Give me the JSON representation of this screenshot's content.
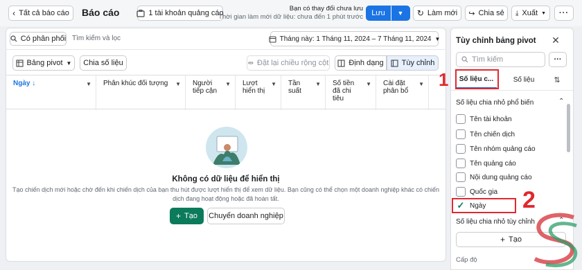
{
  "header": {
    "back_label": "Tất cả báo cáo",
    "title": "Báo cáo",
    "accounts_label": "1 tài khoản quảng cáo",
    "unsaved_title": "Bạn có thay đổi chưa lưu",
    "unsaved_sub": "Thời gian làm mới dữ liệu: chưa đến 1 phút trước",
    "save_label": "Lưu",
    "refresh_label": "Làm mới",
    "share_label": "Chia sẻ",
    "export_label": "Xuất"
  },
  "filters": {
    "chip_label": "Có phân phối",
    "search_placeholder": "Tìm kiếm và lọc",
    "date_range": "Tháng này: 1 Tháng 11, 2024 – 7 Tháng 11, 2024"
  },
  "toolbar": {
    "pivot_label": "Bảng pivot",
    "split_label": "Chia số liệu",
    "reset_width_label": "Đặt lại chiều rộng cột",
    "format_label": "Định dạng",
    "customize_label": "Tùy chỉnh"
  },
  "table": {
    "columns": [
      "Ngày ↓",
      "Phân khúc đối tượng",
      "Người tiếp cận",
      "Lượt hiển thị",
      "Tần suất",
      "Số tiền đã chi tiêu",
      "Cài đặt phân bổ"
    ]
  },
  "empty_state": {
    "title": "Không có dữ liệu để hiển thị",
    "description": "Tạo chiến dịch mới hoặc chờ đến khi chiến dịch của bạn thu hút được lượt hiển thị để xem dữ liệu. Bạn cũng có thể chọn một doanh nghiệp khác có chiến dịch đang hoạt động hoặc đã hoàn tất.",
    "create_label": "Tạo",
    "switch_label": "Chuyển doanh nghiệp"
  },
  "side_panel": {
    "title": "Tùy chỉnh bảng pivot",
    "search_placeholder": "Tìm kiếm",
    "tab_breakdowns": "Số liệu c...",
    "tab_metrics": "Số liệu",
    "section_common": "Số liệu chia nhỏ phổ biến",
    "items": [
      {
        "label": "Tên tài khoản",
        "checked": false
      },
      {
        "label": "Tên chiến dịch",
        "checked": false
      },
      {
        "label": "Tên nhóm quảng cáo",
        "checked": false
      },
      {
        "label": "Tên quảng cáo",
        "checked": false
      },
      {
        "label": "Nội dung quảng cáo",
        "checked": false
      },
      {
        "label": "Quốc gia",
        "checked": false
      },
      {
        "label": "Ngày",
        "checked": true
      }
    ],
    "section_custom": "Số liệu chia nhỏ tùy chỉnh",
    "create_label": "Tạo",
    "bottom_label": "Cấp độ"
  },
  "annotations": {
    "num1": "1",
    "num2": "2"
  },
  "colors": {
    "accent_blue": "#1b74e4",
    "green": "#0b7b5b",
    "annotation_red": "#e0282e"
  }
}
